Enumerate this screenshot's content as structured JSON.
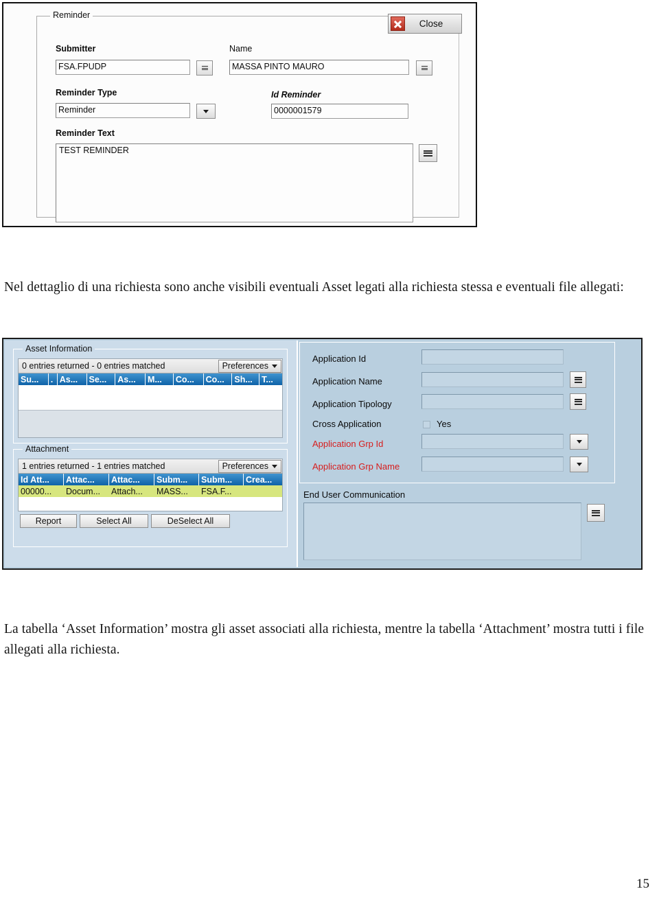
{
  "document": {
    "paragraph_1": "Nel dettaglio di una richiesta sono anche visibili eventuali Asset legati alla richiesta stessa e eventuali file allegati:",
    "paragraph_2": "La tabella ‘Asset Information’ mostra gli asset associati alla richiesta, mentre la tabella ‘Attachment’ mostra tutti i file allegati alla richiesta.",
    "page_number": "15"
  },
  "reminder_dialog": {
    "group_title": "Reminder",
    "close_button": "Close",
    "close_icon": "red-x-icon",
    "fields": {
      "submitter_label": "Submitter",
      "submitter_value": "FSA.FPUDP",
      "name_label": "Name",
      "name_value": "MASSA PINTO MAURO",
      "reminder_type_label": "Reminder Type",
      "reminder_type_value": "Reminder",
      "id_reminder_label": "Id Reminder",
      "id_reminder_value": "0000001579",
      "reminder_text_label": "Reminder Text",
      "reminder_text_value": "TEST REMINDER"
    },
    "icons": {
      "menu": "menu-lines-icon",
      "dropdown": "chevron-down-icon"
    }
  },
  "asset_panel": {
    "group_title": "Asset Information",
    "status_text": "0 entries returned - 0 entries matched",
    "preferences_label": "Preferences",
    "columns": [
      "Su...",
      ".",
      "As...",
      "Se...",
      "As...",
      "M...",
      "Co...",
      "Co...",
      "Sh...",
      "T..."
    ],
    "rows": []
  },
  "attachment_panel": {
    "group_title": "Attachment",
    "status_text": "1 entries returned - 1 entries matched",
    "preferences_label": "Preferences",
    "columns": [
      "Id Att...",
      "Attac...",
      "Attac...",
      "Subm...",
      "Subm...",
      "Crea..."
    ],
    "rows": [
      [
        "00000...",
        "Docum...",
        "Attach...",
        "MASS...",
        "FSA.F...",
        ""
      ]
    ],
    "buttons": [
      "Report",
      "Select All",
      "DeSelect All"
    ]
  },
  "application_panel": {
    "fields": [
      {
        "label": "Application Id",
        "value": "",
        "control": "none",
        "red": false
      },
      {
        "label": "Application Name",
        "value": "",
        "control": "menu",
        "red": false
      },
      {
        "label": "Application Tipology",
        "value": "",
        "control": "menu",
        "red": false
      },
      {
        "label": "Cross Application",
        "value": "Yes",
        "control": "checkbox",
        "red": false
      },
      {
        "label": "Application Grp Id",
        "value": "",
        "control": "dropdown",
        "red": true
      },
      {
        "label": "Application Grp Name",
        "value": "",
        "control": "dropdown",
        "red": true
      }
    ],
    "end_user_communication_label": "End User Communication",
    "end_user_communication_value": "",
    "colors": {
      "panel_background": "#b9cfdf",
      "field_background": "#c3d6e4",
      "required_label": "#d71d1d",
      "table_header": "#1b6fb0",
      "selected_row": "#d7e67e"
    }
  }
}
